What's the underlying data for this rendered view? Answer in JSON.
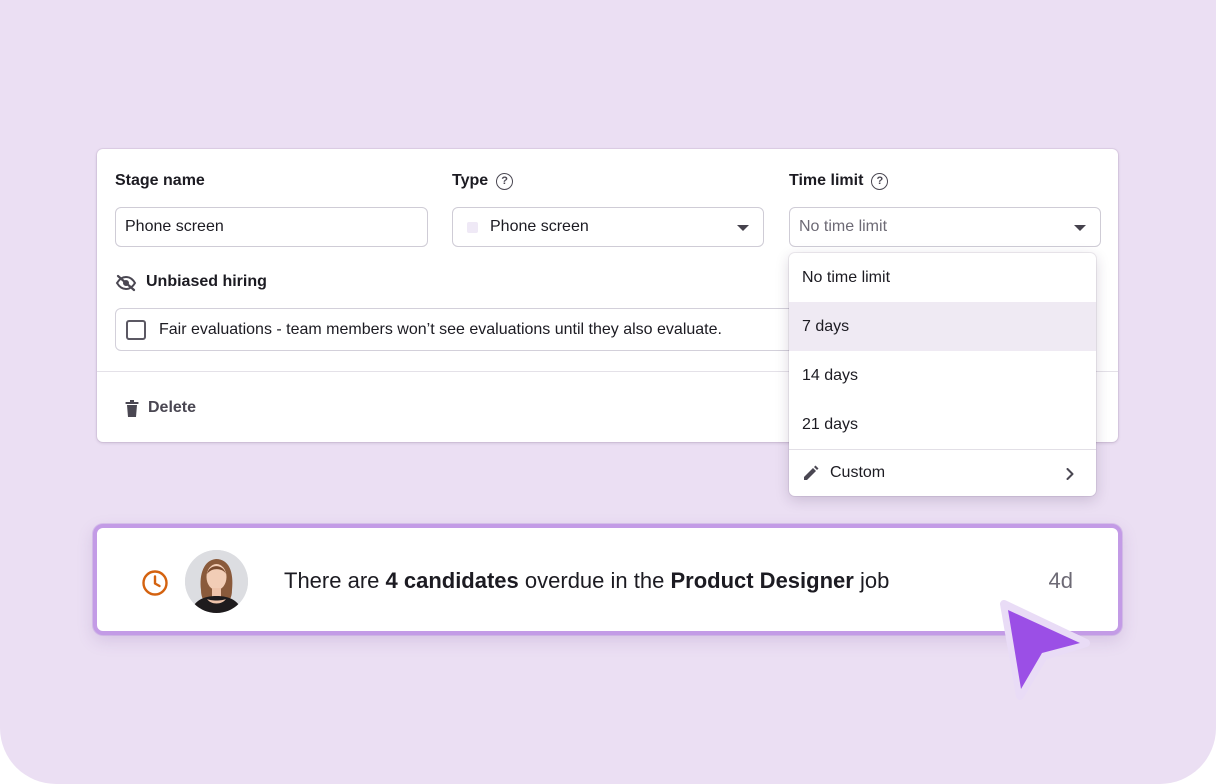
{
  "stage_form": {
    "stage_name_label": "Stage name",
    "stage_name_value": "Phone screen",
    "type_label": "Type",
    "type_value": "Phone screen",
    "time_limit_label": "Time limit",
    "time_limit_placeholder": "No time limit",
    "unbiased_label": "Unbiased hiring",
    "fair_evaluations_text": "Fair evaluations - team members won’t see evaluations until they also evaluate.",
    "delete_label": "Delete"
  },
  "time_limit_dropdown": {
    "options": [
      {
        "label": "No time limit",
        "selected": false
      },
      {
        "label": "7 days",
        "selected": true
      },
      {
        "label": "14 days",
        "selected": false
      },
      {
        "label": "21 days",
        "selected": false
      }
    ],
    "custom_label": "Custom"
  },
  "notification": {
    "text_before": "There are ",
    "count_text": "4 candidates",
    "text_middle": " overdue in the ",
    "job_name": "Product Designer",
    "text_after": " job",
    "age": "4d"
  },
  "icons": [
    "help-circle-icon",
    "eye-off-icon",
    "trash-icon",
    "pencil-icon",
    "chevron-right-icon",
    "clock-icon",
    "cursor-arrow-icon"
  ],
  "colors": {
    "background": "#ebdff3",
    "notification_border": "#c39be6",
    "clock_orange": "#d4620f",
    "cursor_purple": "#9b4fe6"
  }
}
